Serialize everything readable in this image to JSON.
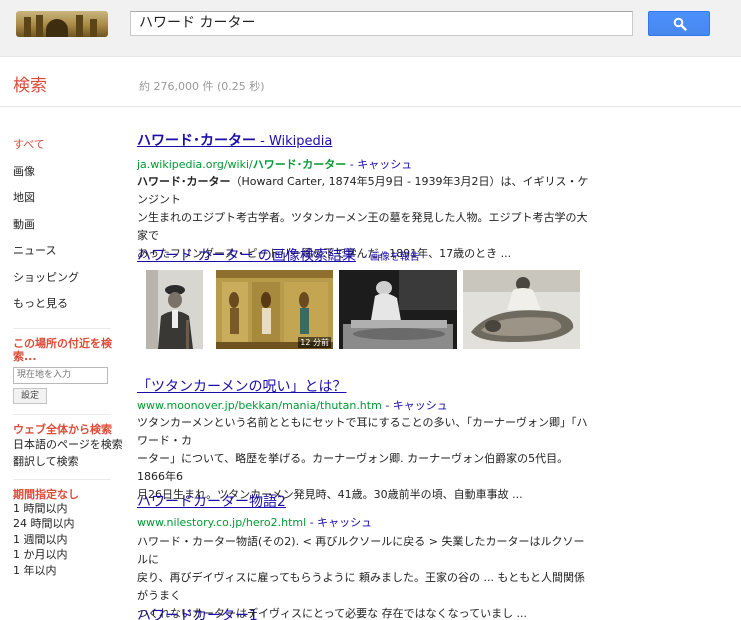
{
  "header": {
    "query": "ハワード カーター",
    "search_button_icon": "search-icon"
  },
  "subheader": {
    "title": "検索",
    "stats": "約 276,000 件 (0.25 秒)"
  },
  "sidebar": {
    "types": [
      {
        "label": "すべて",
        "active": true
      },
      {
        "label": "画像"
      },
      {
        "label": "地図"
      },
      {
        "label": "動画"
      },
      {
        "label": "ニュース"
      },
      {
        "label": "ショッピング"
      },
      {
        "label": "もっと見る"
      }
    ],
    "location": {
      "heading": "この場所の付近を検索...",
      "input_placeholder": "現在地を入力",
      "button": "設定"
    },
    "web": {
      "heading": "ウェブ全体から検索",
      "items": [
        "日本語のページを検索",
        "翻訳して検索"
      ]
    },
    "time": {
      "heading": "期間指定なし",
      "items": [
        "1 時間以内",
        "24 時間以内",
        "1 週間以内",
        "1 か月以内",
        "1 年以内"
      ]
    }
  },
  "results": [
    {
      "title": "ハワード･カーター",
      "title_suffix": " - Wikipedia",
      "url_prefix": "ja.wikipedia.org/wiki/",
      "url_bold": "ハワード･カーター",
      "cache": " - キャッシュ",
      "snippet_bold": "ハワード･カーター",
      "snippet_lines": [
        "（Howard Carter, 1874年5月9日 - 1939年3月2日）は、イギリス・ケンジント",
        "ン生まれのエジプト考古学者。ツタンカーメン王の墓を発見した人物。エジプト考古学の大家で",
        "あったフリンダース・ピートリー卿の下で学んだ。1891年、17歳のとき ..."
      ]
    },
    {
      "title": "「ツタンカーメンの呪い」とは？",
      "url": "www.moonover.jp/bekkan/mania/thutan.htm",
      "cache": " - キャッシュ",
      "snippet_lines": [
        "ツタンカーメンという名前とともにセットで耳にすることの多い、「カーナーヴォン卿」「ハワード・カ",
        "ーター」について、略歴を挙げる。カーナーヴォン卿. カーナーヴォン伯爵家の5代目。1866年6",
        "月26日生まれ。ツタンカーメン発見時、41歳。30歳前半の頃、自動車事故 ..."
      ]
    },
    {
      "title": "ハワードカーター物語2",
      "url": "www.nilestory.co.jp/hero2.html",
      "cache": " - キャッシュ",
      "snippet_lines": [
        "ハワード・カーター物語(その2). < 再びルクソールに戻る > 失業したカーターはルクソールに",
        "戻り、再びデイヴィスに雇ってもらうように 頼みました。王家の谷の ... もともと人間関係がうまく",
        "つくれないカーターはデイヴィスにとって必要な 存在ではなくなっていまし ..."
      ]
    },
    {
      "title": "ハワードカーター1"
    }
  ],
  "images": {
    "link": "ハワード カーター の画像検索結果",
    "report": " - 画像を報告",
    "thumbnails": [
      {
        "name": "portrait-photo"
      },
      {
        "name": "tomb-mural-photo",
        "badge": "12 分前"
      },
      {
        "name": "sarcophagus-photo"
      },
      {
        "name": "mummy-case-photo"
      }
    ]
  },
  "colors": {
    "accent_red": "#dd4b39",
    "link_blue": "#1a0dab",
    "url_green": "#093",
    "search_button_blue": "#4d90fe"
  }
}
